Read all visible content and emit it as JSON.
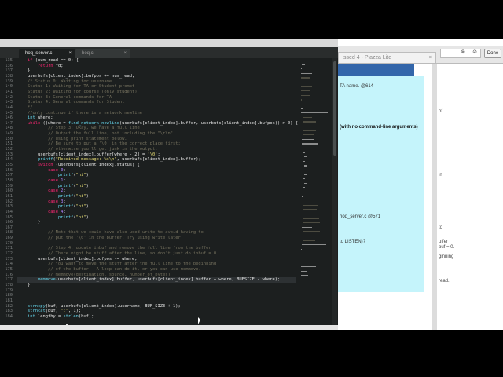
{
  "editor": {
    "tabs": [
      {
        "label": "hoq_server.c",
        "active": true,
        "close": "×"
      },
      {
        "label": "hoq.c",
        "active": false,
        "close": "×"
      }
    ],
    "lines": [
      {
        "n": "135",
        "segs": [
          [
            "    ",
            "#e8e8e8"
          ],
          [
            "if",
            "#f92672"
          ],
          [
            " (num_read == 0) {",
            "#e8e8e8"
          ]
        ]
      },
      {
        "n": "136",
        "segs": [
          [
            "        ",
            "#e8e8e8"
          ],
          [
            "return",
            "#f92672"
          ],
          [
            " fd;",
            "#e8e8e8"
          ]
        ]
      },
      {
        "n": "137",
        "segs": [
          [
            "    }",
            "#e8e8e8"
          ]
        ]
      },
      {
        "n": "138",
        "segs": [
          [
            "    userbufs[client_index].bufpos += num_read;",
            "#e8e8e8"
          ]
        ]
      },
      {
        "n": "139",
        "segs": [
          [
            "    /* Status 0: Waiting for username",
            "#75715e"
          ]
        ]
      },
      {
        "n": "140",
        "segs": [
          [
            "    Status 1: Waiting for TA or Student prompt",
            "#75715e"
          ]
        ]
      },
      {
        "n": "141",
        "segs": [
          [
            "    Status 2: Waiting for course (only student)",
            "#75715e"
          ]
        ]
      },
      {
        "n": "142",
        "segs": [
          [
            "    Status 3: General commands for TA",
            "#75715e"
          ]
        ]
      },
      {
        "n": "143",
        "segs": [
          [
            "    Status 4: General commands for Student",
            "#75715e"
          ]
        ]
      },
      {
        "n": "144",
        "segs": [
          [
            "    */",
            "#75715e"
          ]
        ]
      },
      {
        "n": "145",
        "segs": [
          [
            "    //only continue if there is a network newline",
            "#75715e"
          ]
        ]
      },
      {
        "n": "146",
        "segs": [
          [
            "    ",
            "#e8e8e8"
          ],
          [
            "int",
            "#66d9ef"
          ],
          [
            " where;",
            "#e8e8e8"
          ]
        ]
      },
      {
        "n": "147",
        "segs": [
          [
            "    ",
            "#e8e8e8"
          ],
          [
            "while",
            "#f92672"
          ],
          [
            " ((where = ",
            "#e8e8e8"
          ],
          [
            "find_network_newline",
            "#66d9ef"
          ],
          [
            "(userbufs[client_index].buffer, userbufs[client_index].bufpos)) > 0) {",
            "#e8e8e8"
          ]
        ]
      },
      {
        "n": "148",
        "segs": [
          [
            "            // Step 3: Okay, we have a full line.",
            "#75715e"
          ]
        ]
      },
      {
        "n": "149",
        "segs": [
          [
            "            // Output the full line, not including the \"\\r\\n\",",
            "#75715e"
          ]
        ]
      },
      {
        "n": "150",
        "segs": [
          [
            "            // using print statement below.",
            "#75715e"
          ]
        ]
      },
      {
        "n": "151",
        "segs": [
          [
            "            // Be sure to put a '\\0' in the correct place first;",
            "#75715e"
          ]
        ]
      },
      {
        "n": "152",
        "segs": [
          [
            "            // otherwise you'll get junk in the output.",
            "#75715e"
          ]
        ]
      },
      {
        "n": "153",
        "segs": [
          [
            "        userbufs[client_index].buffer[where - 2] = ",
            "#e8e8e8"
          ],
          [
            "'\\0'",
            "#e6db74"
          ],
          [
            ";",
            "#e8e8e8"
          ]
        ]
      },
      {
        "n": "154",
        "segs": [
          [
            "        ",
            "#e8e8e8"
          ],
          [
            "printf",
            "#66d9ef"
          ],
          [
            "(",
            "#e8e8e8"
          ],
          [
            "\"Received message: %s\\n\"",
            "#e6db74"
          ],
          [
            ", userbufs[client_index].buffer);",
            "#e8e8e8"
          ]
        ]
      },
      {
        "n": "155",
        "segs": [
          [
            "        ",
            "#e8e8e8"
          ],
          [
            "switch",
            "#f92672"
          ],
          [
            " (userbufs[client_index].status) {",
            "#e8e8e8"
          ]
        ]
      },
      {
        "n": "156",
        "segs": [
          [
            "            ",
            "#e8e8e8"
          ],
          [
            "case",
            "#f92672"
          ],
          [
            " ",
            "#e8e8e8"
          ],
          [
            "0",
            "#ae81ff"
          ],
          [
            ":",
            "#e8e8e8"
          ]
        ]
      },
      {
        "n": "157",
        "segs": [
          [
            "                ",
            "#e8e8e8"
          ],
          [
            "printf",
            "#66d9ef"
          ],
          [
            "(",
            "#e8e8e8"
          ],
          [
            "\"hi\"",
            "#e6db74"
          ],
          [
            ");",
            "#e8e8e8"
          ]
        ]
      },
      {
        "n": "158",
        "segs": [
          [
            "            ",
            "#e8e8e8"
          ],
          [
            "case",
            "#f92672"
          ],
          [
            " ",
            "#e8e8e8"
          ],
          [
            "1",
            "#ae81ff"
          ],
          [
            ":",
            "#e8e8e8"
          ]
        ]
      },
      {
        "n": "159",
        "segs": [
          [
            "                ",
            "#e8e8e8"
          ],
          [
            "printf",
            "#66d9ef"
          ],
          [
            "(",
            "#e8e8e8"
          ],
          [
            "\"hi\"",
            "#e6db74"
          ],
          [
            ");",
            "#e8e8e8"
          ]
        ]
      },
      {
        "n": "160",
        "segs": [
          [
            "            ",
            "#e8e8e8"
          ],
          [
            "case",
            "#f92672"
          ],
          [
            " ",
            "#e8e8e8"
          ],
          [
            "2",
            "#ae81ff"
          ],
          [
            ":",
            "#e8e8e8"
          ]
        ]
      },
      {
        "n": "161",
        "segs": [
          [
            "                ",
            "#e8e8e8"
          ],
          [
            "printf",
            "#66d9ef"
          ],
          [
            "(",
            "#e8e8e8"
          ],
          [
            "\"hi\"",
            "#e6db74"
          ],
          [
            ");",
            "#e8e8e8"
          ]
        ]
      },
      {
        "n": "162",
        "segs": [
          [
            "            ",
            "#e8e8e8"
          ],
          [
            "case",
            "#f92672"
          ],
          [
            " ",
            "#e8e8e8"
          ],
          [
            "3",
            "#ae81ff"
          ],
          [
            ":",
            "#e8e8e8"
          ]
        ]
      },
      {
        "n": "163",
        "segs": [
          [
            "                ",
            "#e8e8e8"
          ],
          [
            "printf",
            "#66d9ef"
          ],
          [
            "(",
            "#e8e8e8"
          ],
          [
            "\"hi\"",
            "#e6db74"
          ],
          [
            ");",
            "#e8e8e8"
          ]
        ]
      },
      {
        "n": "164",
        "segs": [
          [
            "            ",
            "#e8e8e8"
          ],
          [
            "case",
            "#f92672"
          ],
          [
            " ",
            "#e8e8e8"
          ],
          [
            "4",
            "#ae81ff"
          ],
          [
            ":",
            "#e8e8e8"
          ]
        ]
      },
      {
        "n": "165",
        "segs": [
          [
            "                ",
            "#e8e8e8"
          ],
          [
            "printf",
            "#66d9ef"
          ],
          [
            "(",
            "#e8e8e8"
          ],
          [
            "\"hi\"",
            "#e6db74"
          ],
          [
            ");",
            "#e8e8e8"
          ]
        ]
      },
      {
        "n": "166",
        "segs": [
          [
            "        }",
            "#e8e8e8"
          ]
        ]
      },
      {
        "n": "167",
        "segs": [
          [
            "",
            "#e8e8e8"
          ]
        ]
      },
      {
        "n": "168",
        "segs": [
          [
            "            // Note that we could have also used write to avoid having to",
            "#75715e"
          ]
        ]
      },
      {
        "n": "169",
        "segs": [
          [
            "            // put the '\\0' in the buffer. Try using write later!",
            "#75715e"
          ]
        ]
      },
      {
        "n": "170",
        "segs": [
          [
            "",
            "#e8e8e8"
          ]
        ]
      },
      {
        "n": "171",
        "segs": [
          [
            "            // Step 4: update inbuf and remove the full line from the buffer",
            "#75715e"
          ]
        ]
      },
      {
        "n": "172",
        "segs": [
          [
            "            // There might be stuff after the line, so don't just do inbuf = 0.",
            "#75715e"
          ]
        ]
      },
      {
        "n": "173",
        "segs": [
          [
            "        userbufs[client_index].bufpos -= where;",
            "#e8e8e8"
          ]
        ]
      },
      {
        "n": "174",
        "segs": [
          [
            "            // You want to move the stuff after the full line to the beginning",
            "#75715e"
          ]
        ]
      },
      {
        "n": "175",
        "segs": [
          [
            "            // of the buffer.  A loop can do it, or you can use memmove.",
            "#75715e"
          ]
        ]
      },
      {
        "n": "176",
        "segs": [
          [
            "            // memmove(destination, source, number_of_bytes)",
            "#75715e"
          ]
        ]
      },
      {
        "n": "177",
        "segs": [
          [
            "        ",
            "#e8e8e8"
          ],
          [
            "memmove",
            "#66d9ef"
          ],
          [
            "(userbufs[client_index].buffer, userbufs[client_index].buffer + where, BUFSIZE - where);",
            "#e8e8e8"
          ]
        ]
      },
      {
        "n": "178",
        "segs": [
          [
            "    }",
            "#e8e8e8"
          ]
        ]
      },
      {
        "n": "179",
        "segs": [
          [
            "",
            "#e8e8e8"
          ]
        ]
      },
      {
        "n": "180",
        "segs": [
          [
            "",
            "#e8e8e8"
          ]
        ]
      },
      {
        "n": "181",
        "segs": [
          [
            "",
            "#e8e8e8"
          ]
        ]
      },
      {
        "n": "182",
        "segs": [
          [
            "    ",
            "#e8e8e8"
          ],
          [
            "strncpy",
            "#66d9ef"
          ],
          [
            "(buf, userbufs[client_index].username, BUF_SIZE + 1);",
            "#e8e8e8"
          ]
        ]
      },
      {
        "n": "183",
        "segs": [
          [
            "    ",
            "#e8e8e8"
          ],
          [
            "strncat",
            "#66d9ef"
          ],
          [
            "(buf, ",
            "#e8e8e8"
          ],
          [
            "\":\"",
            "#e6db74"
          ],
          [
            ", 1);",
            "#e8e8e8"
          ]
        ]
      },
      {
        "n": "184",
        "segs": [
          [
            "    ",
            "#e8e8e8"
          ],
          [
            "int",
            "#66d9ef"
          ],
          [
            " lengthy = ",
            "#e8e8e8"
          ],
          [
            "strlen",
            "#66d9ef"
          ],
          [
            "(buf);",
            "#e8e8e8"
          ]
        ]
      }
    ]
  },
  "browser": {
    "tab_title": "ssed 4 - Piazza Lite",
    "tab_close": "×",
    "nav_buttons": [
      "⊗",
      "⊘"
    ],
    "done_label": "Done",
    "panel_lines": [
      {
        "text": "TA name. @614"
      },
      {
        "text": "(with no command-line arguments)"
      },
      {
        "text": "hoq_server.c @571"
      },
      {
        "text": "to LISTEN)?"
      }
    ],
    "right_lines": [
      {
        "text": "of"
      },
      {
        "text": "in"
      },
      {
        "text": "to"
      },
      {
        "text": "uffer"
      },
      {
        "text": "buf = 0."
      },
      {
        "text": "ginning"
      },
      {
        "text": "read."
      }
    ]
  },
  "colors": {
    "editor_bg": "#1c1f1f",
    "panel_cyan": "#c5f4fb",
    "header_blue": "#3366aa"
  }
}
